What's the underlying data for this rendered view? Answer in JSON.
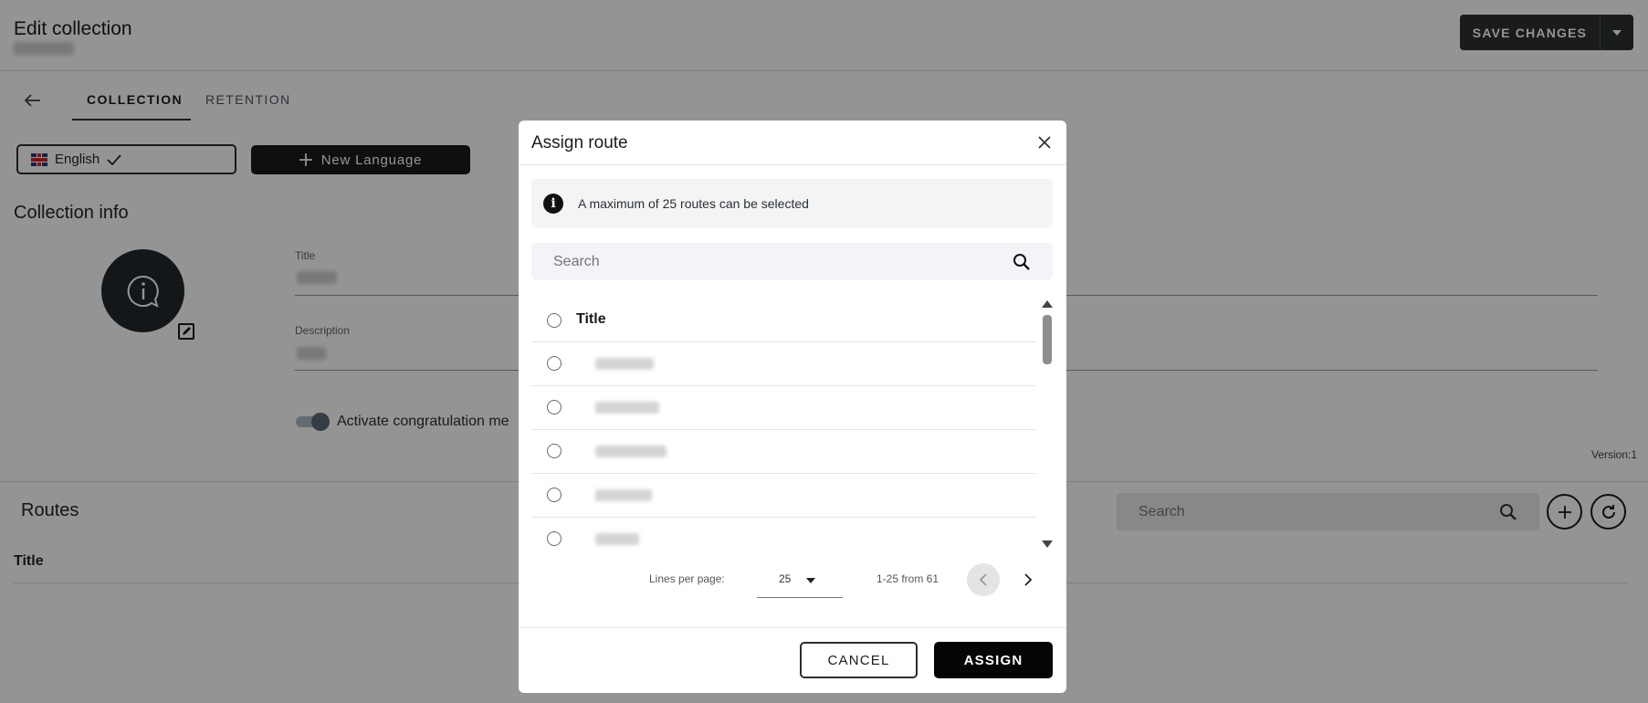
{
  "header": {
    "title": "Edit collection",
    "save_label": "SAVE CHANGES",
    "save_dropdown_icon": "caret-down-icon"
  },
  "tabs": [
    {
      "label": "COLLECTION",
      "active": true
    },
    {
      "label": "RETENTION",
      "active": false
    }
  ],
  "language": {
    "current": "English",
    "flag_icon": "uk-flag-icon",
    "check_icon": "check-icon",
    "new_language_label": "New Language"
  },
  "collection_info": {
    "section_title": "Collection info",
    "title_label": "Title",
    "description_label": "Description",
    "toggle_label": "Activate congratulation me",
    "toggle_on": true,
    "version": "Version:1"
  },
  "routes": {
    "section_title": "Routes",
    "search_placeholder": "Search",
    "column_title": "Title"
  },
  "modal": {
    "title": "Assign route",
    "info_text": "A maximum of 25 routes can be selected",
    "search_placeholder": "Search",
    "column_title": "Title",
    "row_count_visible": 5,
    "pager": {
      "lines_label": "Lines per page:",
      "lines_value": "25",
      "range_text": "1-25 from 61"
    },
    "cancel_label": "CANCEL",
    "assign_label": "ASSIGN"
  },
  "colors": {
    "primary_dark": "#1b1b1b",
    "overlay": "rgba(0,0,0,0.42)",
    "surface_light": "#f3f4f5"
  }
}
